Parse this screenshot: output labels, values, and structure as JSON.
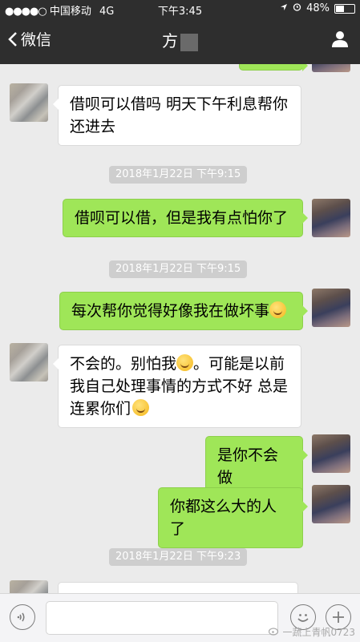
{
  "status_bar": {
    "signal": "●●●●○",
    "carrier": "中国移动",
    "network": "4G",
    "time": "下午3:45",
    "battery": "48%",
    "battery_level": 0.48
  },
  "nav": {
    "back_label": "微信",
    "title": "方"
  },
  "messages": [
    {
      "side": "in",
      "text": "借呗可以借吗 明天下午利息帮你还进去"
    },
    {
      "type": "timestamp",
      "text": "2018年1月22日 下午9:15"
    },
    {
      "side": "out",
      "text": "借呗可以借，但是我有点怕你了"
    },
    {
      "type": "timestamp",
      "text": "2018年1月22日 下午9:15"
    },
    {
      "side": "out",
      "text": "每次帮你觉得好像我在做坏事"
    },
    {
      "side": "in",
      "text_a": "不会的。别怕我",
      "text_b": "。可能是以前我自己处理事情的方式不好 总是连累你们"
    },
    {
      "side": "out",
      "text": "是你不会做"
    },
    {
      "side": "out",
      "text": "你都这么大的人了"
    },
    {
      "type": "timestamp",
      "text": "2018年1月22日 下午9:23"
    }
  ],
  "input": {
    "placeholder": ""
  },
  "icons": {
    "voice": "voice-icon",
    "emoji": "emoji-icon",
    "plus": "plus-icon"
  },
  "watermark": "一蔬上青帆0723"
}
